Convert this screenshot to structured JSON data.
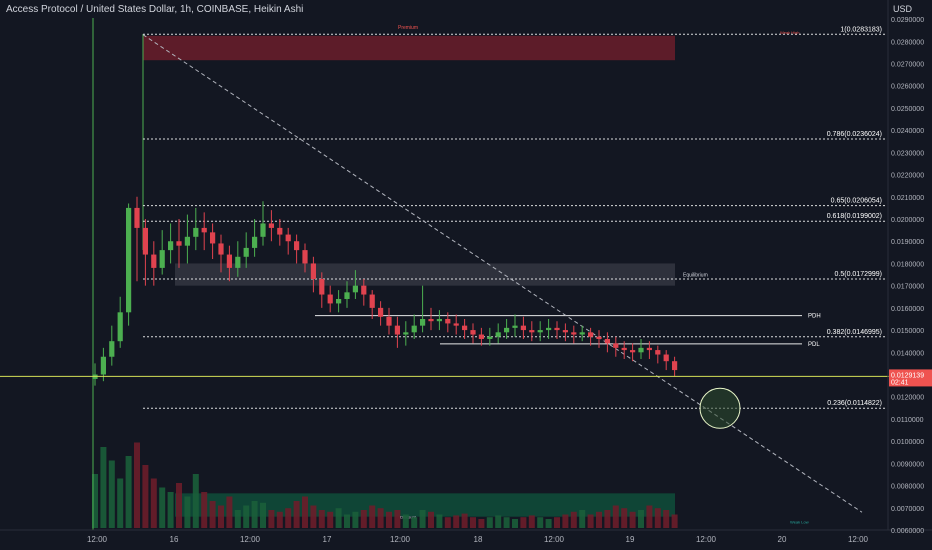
{
  "header": {
    "title": "Access Protocol / United States Dollar, 1h, COINBASE, Heikin Ashi",
    "currency": "USD"
  },
  "chart_data": {
    "type": "candlestick",
    "y_ticks": [
      "0.0290000",
      "0.0280000",
      "0.0270000",
      "0.0260000",
      "0.0250000",
      "0.0240000",
      "0.0230000",
      "0.0220000",
      "0.0210000",
      "0.0200000",
      "0.0190000",
      "0.0180000",
      "0.0170000",
      "0.0160000",
      "0.0150000",
      "0.0140000",
      "0.0130000",
      "0.0120000",
      "0.0110000",
      "0.0100000",
      "0.0090000",
      "0.0080000",
      "0.0070000",
      "0.0060000"
    ],
    "ylim": [
      0.006,
      0.02905
    ],
    "x_ticks": [
      "12:00",
      "16",
      "12:00",
      "17",
      "12:00",
      "18",
      "12:00",
      "19",
      "12:00",
      "20",
      "12:00"
    ],
    "last_price": {
      "value": 0.012914,
      "label": "0.0129139",
      "countdown": "02:41"
    },
    "fib_levels": [
      {
        "label": "1(0.0283183)",
        "value": 0.0283183
      },
      {
        "label": "0.786(0.0236024)",
        "value": 0.0236024
      },
      {
        "label": "0.65(0.0206054)",
        "value": 0.0206054
      },
      {
        "label": "0.618(0.0199002)",
        "value": 0.0199002
      },
      {
        "label": "0.5(0.0172999)",
        "value": 0.0172999
      },
      {
        "label": "0.382(0.0146995)",
        "value": 0.0146995
      },
      {
        "label": "0.236(0.0114822)",
        "value": 0.0114822
      }
    ],
    "levels": [
      {
        "label": "PDH",
        "value": 0.01565
      },
      {
        "label": "PDL",
        "value": 0.01438
      }
    ],
    "zones": [
      {
        "label": "Premium",
        "top": 0.02825,
        "bottom": 0.02715,
        "side_label": "Weak High"
      },
      {
        "label": "Equilibrium",
        "top": 0.018,
        "bottom": 0.017
      },
      {
        "label": "Discount",
        "top": 0.00765,
        "bottom": 0.0066,
        "side_label": "Weak Low"
      }
    ],
    "candles": [
      [
        0.0128,
        0.013,
        0.0135,
        0.0125
      ],
      [
        0.013,
        0.0138,
        0.0142,
        0.0127
      ],
      [
        0.0138,
        0.0145,
        0.0152,
        0.0134
      ],
      [
        0.0145,
        0.0158,
        0.0165,
        0.0142
      ],
      [
        0.0158,
        0.0205,
        0.0207,
        0.0152
      ],
      [
        0.0205,
        0.0196,
        0.021,
        0.0172
      ],
      [
        0.0196,
        0.0184,
        0.02,
        0.017
      ],
      [
        0.0184,
        0.0178,
        0.019,
        0.017
      ],
      [
        0.0178,
        0.0186,
        0.0195,
        0.0175
      ],
      [
        0.0186,
        0.019,
        0.0198,
        0.018
      ],
      [
        0.019,
        0.0188,
        0.02,
        0.0178
      ],
      [
        0.0188,
        0.0192,
        0.0202,
        0.018
      ],
      [
        0.0192,
        0.0196,
        0.0205,
        0.0186
      ],
      [
        0.0196,
        0.0194,
        0.0203,
        0.0186
      ],
      [
        0.0194,
        0.0189,
        0.0198,
        0.0182
      ],
      [
        0.0189,
        0.0184,
        0.0193,
        0.0176
      ],
      [
        0.0184,
        0.0178,
        0.0188,
        0.0172
      ],
      [
        0.0178,
        0.0183,
        0.019,
        0.0174
      ],
      [
        0.0183,
        0.0187,
        0.0194,
        0.0178
      ],
      [
        0.0187,
        0.0192,
        0.02,
        0.0183
      ],
      [
        0.0192,
        0.0198,
        0.0208,
        0.0188
      ],
      [
        0.0198,
        0.0196,
        0.0204,
        0.019
      ],
      [
        0.0196,
        0.0193,
        0.02,
        0.0188
      ],
      [
        0.0193,
        0.019,
        0.0196,
        0.0184
      ],
      [
        0.019,
        0.0186,
        0.0193,
        0.018
      ],
      [
        0.0186,
        0.018,
        0.0189,
        0.0176
      ],
      [
        0.018,
        0.0173,
        0.0183,
        0.0167
      ],
      [
        0.0173,
        0.0166,
        0.0176,
        0.016
      ],
      [
        0.0166,
        0.0162,
        0.017,
        0.0158
      ],
      [
        0.0162,
        0.0164,
        0.0168,
        0.0158
      ],
      [
        0.0164,
        0.0167,
        0.0172,
        0.016
      ],
      [
        0.0167,
        0.017,
        0.0177,
        0.0164
      ],
      [
        0.017,
        0.0166,
        0.0173,
        0.0161
      ],
      [
        0.0166,
        0.016,
        0.0168,
        0.0155
      ],
      [
        0.016,
        0.0156,
        0.0163,
        0.0152
      ],
      [
        0.0156,
        0.0152,
        0.016,
        0.0148
      ],
      [
        0.0152,
        0.0148,
        0.0156,
        0.0142
      ],
      [
        0.0148,
        0.0149,
        0.0154,
        0.0143
      ],
      [
        0.0149,
        0.0152,
        0.0157,
        0.0146
      ],
      [
        0.0152,
        0.0155,
        0.017,
        0.0149
      ],
      [
        0.0155,
        0.0154,
        0.016,
        0.015
      ],
      [
        0.0154,
        0.0155,
        0.0159,
        0.015
      ],
      [
        0.0155,
        0.0153,
        0.0158,
        0.0149
      ],
      [
        0.0153,
        0.0152,
        0.0157,
        0.0148
      ],
      [
        0.0152,
        0.015,
        0.0155,
        0.0146
      ],
      [
        0.015,
        0.0148,
        0.0153,
        0.0144
      ],
      [
        0.0148,
        0.0146,
        0.0151,
        0.0143
      ],
      [
        0.0146,
        0.0147,
        0.0151,
        0.0143
      ],
      [
        0.0147,
        0.0149,
        0.0153,
        0.0144
      ],
      [
        0.0149,
        0.0151,
        0.0155,
        0.0146
      ],
      [
        0.0151,
        0.0152,
        0.0157,
        0.0147
      ],
      [
        0.0152,
        0.015,
        0.0156,
        0.0146
      ],
      [
        0.015,
        0.0149,
        0.0154,
        0.0145
      ],
      [
        0.0149,
        0.015,
        0.0154,
        0.0145
      ],
      [
        0.015,
        0.0151,
        0.0155,
        0.0146
      ],
      [
        0.0151,
        0.015,
        0.0154,
        0.0146
      ],
      [
        0.015,
        0.0149,
        0.0153,
        0.0145
      ],
      [
        0.0149,
        0.0148,
        0.0152,
        0.0144
      ],
      [
        0.0148,
        0.0149,
        0.0152,
        0.0145
      ],
      [
        0.0149,
        0.0147,
        0.0151,
        0.0143
      ],
      [
        0.0147,
        0.0146,
        0.015,
        0.0142
      ],
      [
        0.0146,
        0.0144,
        0.0149,
        0.014
      ],
      [
        0.0144,
        0.0142,
        0.0147,
        0.0138
      ],
      [
        0.0142,
        0.0141,
        0.0145,
        0.0137
      ],
      [
        0.0141,
        0.014,
        0.0144,
        0.0136
      ],
      [
        0.014,
        0.0142,
        0.0146,
        0.0137
      ],
      [
        0.0142,
        0.0141,
        0.0145,
        0.0137
      ],
      [
        0.0141,
        0.0139,
        0.0143,
        0.0135
      ],
      [
        0.0139,
        0.0136,
        0.0141,
        0.0132
      ],
      [
        0.0136,
        0.0132,
        0.0138,
        0.0129
      ]
    ],
    "volume": [
      0.6,
      0.9,
      0.75,
      0.55,
      0.8,
      0.95,
      0.7,
      0.55,
      0.45,
      0.4,
      0.5,
      0.35,
      0.6,
      0.4,
      0.3,
      0.25,
      0.35,
      0.2,
      0.25,
      0.3,
      0.28,
      0.2,
      0.18,
      0.22,
      0.3,
      0.35,
      0.25,
      0.2,
      0.18,
      0.22,
      0.15,
      0.18,
      0.2,
      0.25,
      0.22,
      0.18,
      0.2,
      0.15,
      0.12,
      0.2,
      0.18,
      0.15,
      0.12,
      0.14,
      0.16,
      0.12,
      0.1,
      0.12,
      0.14,
      0.12,
      0.1,
      0.12,
      0.14,
      0.12,
      0.1,
      0.12,
      0.15,
      0.18,
      0.2,
      0.15,
      0.18,
      0.2,
      0.25,
      0.22,
      0.18,
      0.2,
      0.25,
      0.22,
      0.2,
      0.15
    ],
    "colors": {
      "up": "#26a69a",
      "down": "#ef5350",
      "up_candle": "#4caf50",
      "down_candle": "#e0434f",
      "fib": "#ffffff",
      "price_line": "#d4e157",
      "zone_premium": "#6b1d2a",
      "zone_eq": "#3a3d47",
      "zone_discount": "#0f4d3a",
      "trend": "#b2b5be"
    }
  }
}
